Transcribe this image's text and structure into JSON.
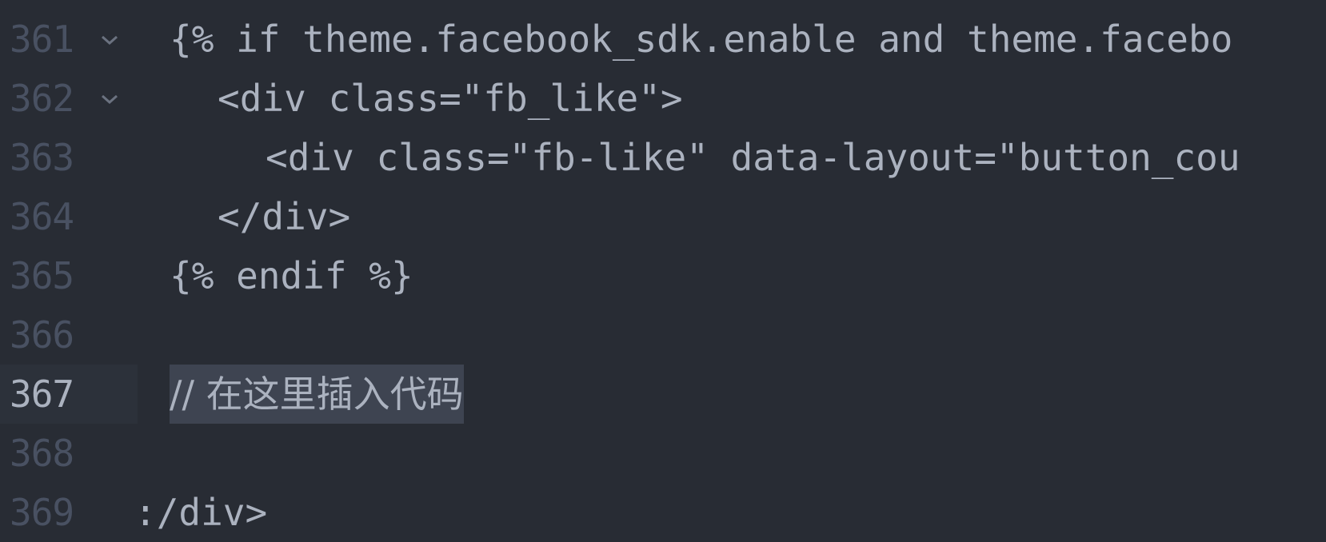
{
  "editor": {
    "colors": {
      "background": "#282c34",
      "gutter_text": "#495162",
      "text": "#abb2bf",
      "selection": "#3e4451",
      "spellcheck_underline": "#c24038"
    },
    "lines": [
      {
        "number": "361",
        "fold": true,
        "parts": [
          "{% if ",
          "theme.facebook_sdk.enable",
          " and ",
          "theme.facebo"
        ]
      },
      {
        "number": "362",
        "fold": true,
        "text": "<div class=\"fb_like\">"
      },
      {
        "number": "363",
        "fold": false,
        "text": "<div class=\"fb-like\" data-layout=\"button_cou"
      },
      {
        "number": "364",
        "fold": false,
        "text": "</div>"
      },
      {
        "number": "365",
        "fold": false,
        "text": "{% endif %}"
      },
      {
        "number": "366",
        "fold": false,
        "text": ""
      },
      {
        "number": "367",
        "fold": false,
        "active": true,
        "text": "// 在这里插入代码"
      },
      {
        "number": "368",
        "fold": false,
        "text": ""
      },
      {
        "number": "369",
        "fold": false,
        "text": ":/div>"
      }
    ]
  }
}
